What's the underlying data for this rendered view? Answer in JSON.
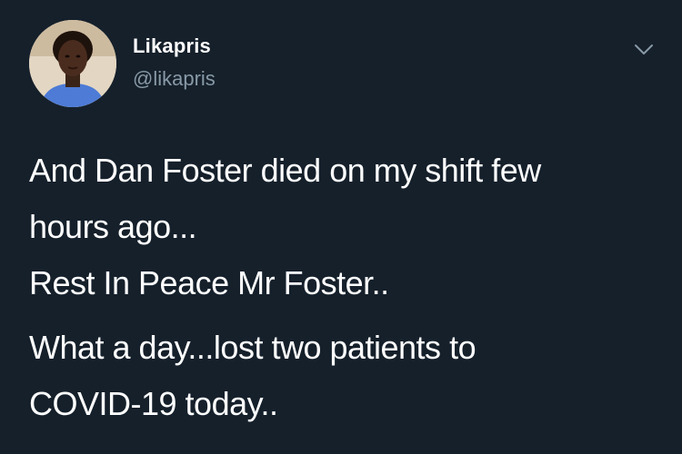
{
  "author": {
    "name": "Likapris",
    "handle": "@likapris"
  },
  "tweet": {
    "lines": [
      "And Dan Foster died on my shift few",
      "hours ago...",
      "Rest In Peace Mr Foster..",
      "What a day...lost two patients to",
      "COVID-19 today.."
    ]
  },
  "icons": {
    "caret": "chevron-down-icon"
  },
  "colors": {
    "background": "#15202b",
    "text": "#ffffff",
    "secondary_text": "#8899a6"
  }
}
